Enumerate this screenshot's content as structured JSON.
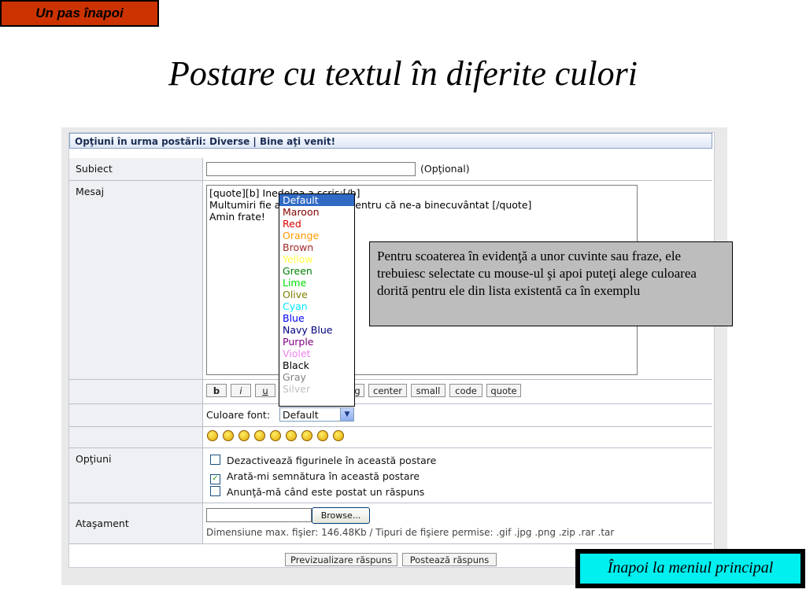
{
  "slide": {
    "back_button": "Un pas înapoi",
    "title": "Postare cu textul în diferite culori",
    "callout": "Pentru scoaterea în evidenţă a unor cuvinte sau fraze, ele trebuiesc selectate cu mouse-ul şi apoi puteţi alege culoarea dorită pentru ele din lista existentă ca în exemplu",
    "menu_button": "Înapoi la meniul principal"
  },
  "form": {
    "caption": "Opţiuni în urma postării: Diverse | Bine aţi venit!",
    "subject_label": "Subiect",
    "subject_note": "(Opţional)",
    "message_label": "Mesaj",
    "message_lines": [
      "[quote][b] Inedelea a scris:[/b]",
      "Multumiri fie a                    i pentru că ne-a binecuvântat [/quote]",
      "",
      "Amin frate!"
    ],
    "format_buttons": [
      "b",
      "i",
      "u",
      "g",
      "center",
      "small",
      "code",
      "quote"
    ],
    "font_color_label": "Culoare font:",
    "font_color_value": "Default",
    "options_label": "Opţiuni",
    "options": [
      {
        "label": "Dezactivează figurinele în această postare",
        "checked": false
      },
      {
        "label": "Arată-mi semnătura în această postare",
        "checked": true
      },
      {
        "label": "Anunţă-mă când este postat un răspuns",
        "checked": false
      }
    ],
    "attachment_label": "Ataşament",
    "browse_label": "Browse...",
    "attachment_note": "Dimensiune max. fişier: 146.48Kb / Tipuri de fişiere permise: .gif .jpg .png .zip .rar .tar",
    "preview_button": "Previzualizare răspuns",
    "post_button": "Postează răspuns"
  },
  "color_dropdown": {
    "items": [
      {
        "label": "Default",
        "color": "#ffffff",
        "selected": true
      },
      {
        "label": "Maroon",
        "color": "#800000"
      },
      {
        "label": "Red",
        "color": "#e00000"
      },
      {
        "label": "Orange",
        "color": "#ff9900"
      },
      {
        "label": "Brown",
        "color": "#a52a2a"
      },
      {
        "label": "Yellow",
        "color": "#ffff44"
      },
      {
        "label": "Green",
        "color": "#008000"
      },
      {
        "label": "Lime",
        "color": "#00dd00"
      },
      {
        "label": "Olive",
        "color": "#808000"
      },
      {
        "label": "Cyan",
        "color": "#00e5ff"
      },
      {
        "label": "Blue",
        "color": "#0000ff"
      },
      {
        "label": "Navy Blue",
        "color": "#000080"
      },
      {
        "label": "Purple",
        "color": "#800080"
      },
      {
        "label": "Violet",
        "color": "#ee82ee"
      },
      {
        "label": "Black",
        "color": "#000000"
      },
      {
        "label": "Gray",
        "color": "#808080"
      },
      {
        "label": "Silver",
        "color": "#c0c0c0"
      }
    ]
  },
  "colors": {
    "back_button_bg": "#cc3300",
    "callout_bg": "#bdbdbd",
    "menu_button_bg": "#00f0f0",
    "dropdown_selection": "#316ac5"
  }
}
